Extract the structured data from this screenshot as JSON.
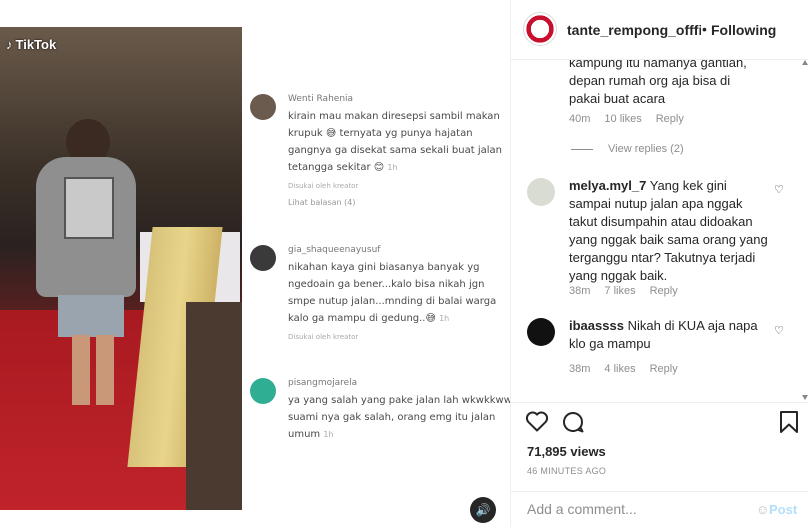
{
  "video": {
    "watermark": "TikTok",
    "inner_comments": [
      {
        "user": "Wenti Rahenia",
        "text": "kirain mau makan diresepsi sambil makan krupuk 😅 ternyata yg punya hajatan gangnya ga disekat sama sekali buat jalan tetangga sekitar 😊",
        "time": "1h",
        "liked_by": "Disukai oleh kreator",
        "replies": "Lihat balasan (4)"
      },
      {
        "user": "gia_shaqueenayusuf",
        "text": "nikahan kaya gini biasanya banyak yg ngedoain ga bener...kalo bisa nikah jgn smpe nutup jalan...mnding di balai warga kalo ga mampu di gedung..😅",
        "time": "1h",
        "liked_by": "Disukai oleh kreator"
      },
      {
        "user": "pisangmojarela",
        "text": "ya yang salah yang pake jalan lah wkwkkww suami nya gak salah, orang emg itu jalan umum",
        "time": "1h"
      }
    ]
  },
  "header": {
    "username": "tante_rempong_offficial",
    "follow_status": "Following"
  },
  "comments": [
    {
      "text": "kampung itu namanya gantian, depan rumah org aja bisa di pakai buat acara",
      "time": "40m",
      "likes": "10 likes",
      "reply": "Reply"
    },
    {
      "view_replies": "View replies (2)"
    },
    {
      "user": "melya.myl_7",
      "text": "Yang kek gini sampai nutup jalan apa nggak takut disumpahin atau didoakan yang nggak baik sama orang yang terganggu ntar? Takutnya terjadi yang nggak baik.",
      "time": "38m",
      "likes": "7 likes",
      "reply": "Reply"
    },
    {
      "user": "ibaassss",
      "text": "Nikah di KUA aja napa klo ga mampu",
      "time": "38m",
      "likes": "4 likes",
      "reply": "Reply"
    }
  ],
  "stats": {
    "views": "71,895 views",
    "posted": "46 MINUTES AGO"
  },
  "add_comment": {
    "placeholder": "Add a comment...",
    "post_label": "Post"
  },
  "icons": {
    "like": "heart-icon",
    "comment": "comment-bubble-icon",
    "save": "bookmark-icon",
    "sound": "speaker-icon",
    "emoji": "smiley-icon"
  },
  "colors": {
    "post_button": "#b2dffc",
    "text": "#262626",
    "meta": "#8e8e8e"
  }
}
